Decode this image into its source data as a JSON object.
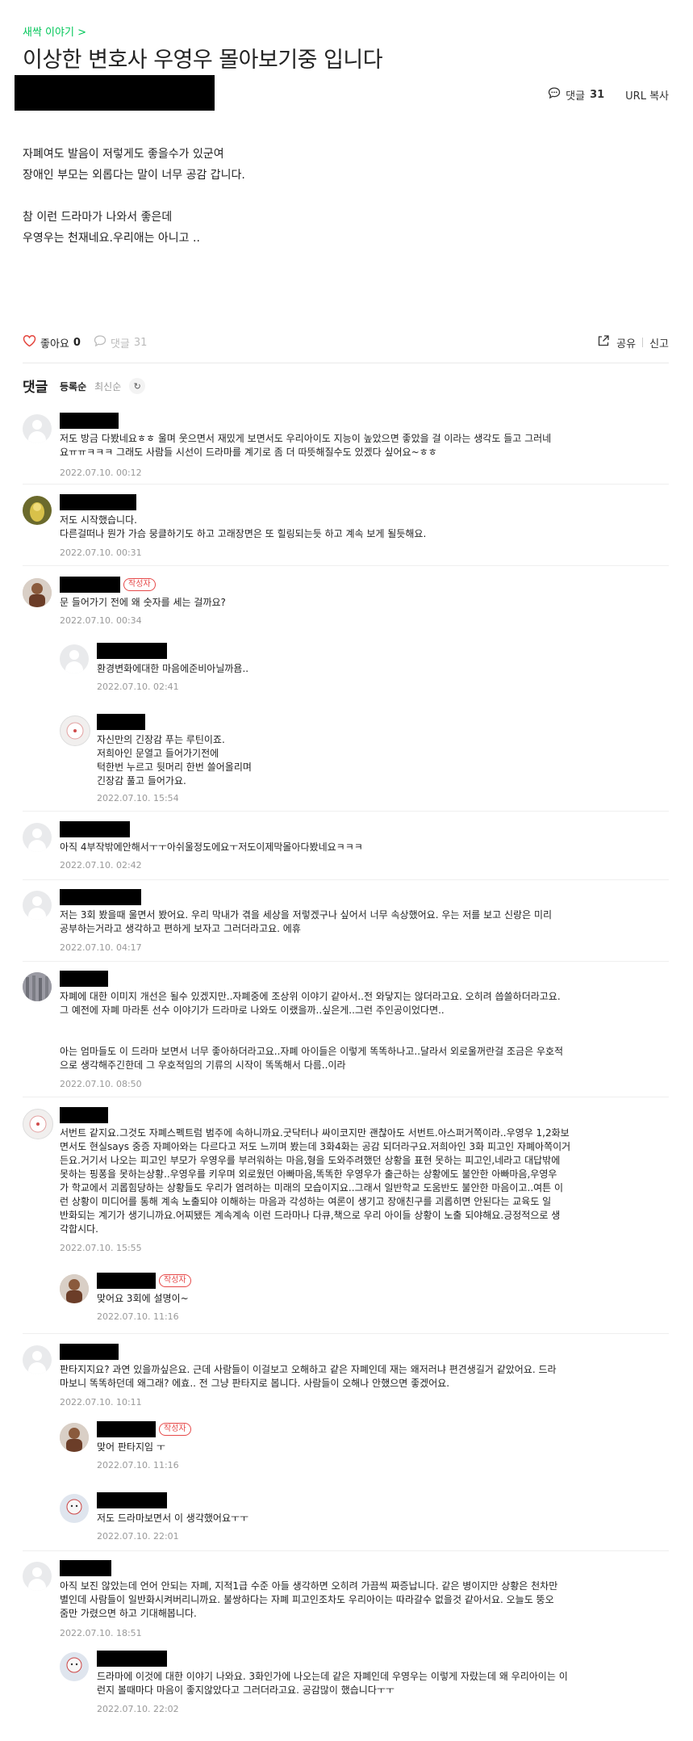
{
  "post": {
    "category": "새싹 이야기 >",
    "title": "이상한 변호사 우영우 몰아보기중 입니다",
    "comment_label": "댓글",
    "comment_count": "31",
    "url_copy": "URL 복사",
    "content_lines": [
      "자폐여도 발음이 저렇게도 좋을수가 있군여",
      "장애인 부모는 외롭다는 말이 너무 공감 갑니다.",
      "",
      "참 이런 드라마가 나와서 좋은데",
      "우영우는 천재네요.우리애는 아니고 .."
    ]
  },
  "actions": {
    "like_label": "좋아요",
    "like_count": "0",
    "comment_label": "댓글",
    "comment_count": "31",
    "share_label": "공유",
    "report_label": "신고"
  },
  "comments_section": {
    "title": "댓글",
    "sort_registered": "등록순",
    "sort_latest": "최신순"
  },
  "comments": [
    {
      "badge": "",
      "lines": [
        "저도 방금 다봤네요ㅎㅎ 울며 웃으면서 재밌게 보면서도 우리아이도 지능이 높았으면 좋았을 걸 이라는 생각도 들고 그러네",
        "요ㅠㅠㅋㅋㅋ 그래도 사람들 시선이 드라마를 계기로 좀 더 따뜻해질수도 있겠다 싶어요~ㅎㅎ"
      ],
      "date": "2022.07.10. 00:12"
    },
    {
      "badge": "",
      "lines": [
        "저도 시작했습니다.",
        "다른걸떠나 뭔가 가슴 뭉클하기도 하고 고래장면은 또 힐링되는듯 하고 계속 보게 될듯해요."
      ],
      "date": "2022.07.10. 00:31"
    },
    {
      "badge": "작성자",
      "lines": [
        "문 들어가기 전에 왜 숫자를 세는 걸까요?"
      ],
      "date": "2022.07.10. 00:34"
    },
    {
      "badge": "",
      "lines": [
        "환경변화에대한 마음에준비아닐까욤.."
      ],
      "date": "2022.07.10. 02:41"
    },
    {
      "badge": "",
      "lines": [
        "자신만의 긴장감 푸는 루틴이죠.",
        "저희아인 문열고 들어가기전에",
        "턱한번 누르고 뒷머리 한번 쓸어올리며",
        "긴장감 풀고 들어가요."
      ],
      "date": "2022.07.10. 15:54"
    },
    {
      "badge": "",
      "lines": [
        "아직 4부작밖에안해서ㅜㅜ아쉬울정도에요ㅜ저도이제막몰아다봤네요ㅋㅋㅋ"
      ],
      "date": "2022.07.10. 02:42"
    },
    {
      "badge": "",
      "lines": [
        "저는 3회 봤을때 울면서 봤어요. 우리 막내가 겪을 세상을 저렇겠구나 싶어서 너무 속상했어요. 우는 저를 보고 신랑은 미리",
        "공부하는거라고 생각하고 편하게 보자고 그러더라고요. 에휴"
      ],
      "date": "2022.07.10. 04:17"
    },
    {
      "badge": "",
      "lines": [
        "자폐에 대한 이미지 개선은 될수 있겠지만..자폐중에 조상위 이야기 같아서..전 와닿지는 않더라고요. 오히려 씁쓸하더라고요.",
        "그 예전에 자폐 마라톤 선수 이야기가 드라마로 나와도 이랬을까..싶은게..그런 주인공이었다면..",
        "",
        "",
        "아는 엄마들도 이 드라마 보면서 너무 좋아하더라고요..자폐 아이들은 이렇게 똑똑하나고..달라서 외로울꺼란걸 조금은 우호적",
        "으로 생각해주긴한데 그 우호적임의 기류의 시작이 똑똑해서 다름..이라"
      ],
      "date": "2022.07.10. 08:50"
    },
    {
      "badge": "",
      "lines": [
        "서번트 같지요.그것도 자폐스펙트럼 범주에 속하니까요.굿닥터나 싸이코지만 괜찮아도 서번트.아스퍼거쪽이라..우영우 1,2화보",
        "면서도 현실says 중증 자폐아와는 다르다고 저도 느끼며 봤는데 3화4화는 공감 되더라구요.저희아인 3화 피고인 자폐아쪽이거",
        "든요.거기서 나오는 피고인 부모가 우영우를 부러워하는 마음,형을 도와주려했던 상황을 표현 못하는 피고인,네라고 대답밖에",
        "못하는 핑퐁을 못하는상황..우영우를 키우며 외로웠던 아빠마음,똑똑한 우영우가 출근하는 상황에도 불안한 아빠마음,우영우",
        "가 학교에서 괴롭힘당하는 상황들도 우리가 염려하는 미래의 모습이지요..그래서 일반학교 도움반도 불안한 마음이고..여튼 이",
        "런 상황이 미디어를 통해 계속 노출되야 이해하는 마음과 각성하는 여론이 생기고 장애친구를 괴롭히면 안된다는 교육도 일",
        "반화되는 계기가 생기니까요.어찌됐든 계속계속 이런 드라마나 다큐,책으로 우리 아이들 상황이 노출 되야해요.긍정적으로 생",
        "각합시다."
      ],
      "date": "2022.07.10. 15:55"
    },
    {
      "badge": "작성자",
      "lines": [
        "맞어요 3회에 설명이~"
      ],
      "date": "2022.07.10. 11:16"
    },
    {
      "badge": "",
      "lines": [
        "판타지지요? 과연 있을까싶은요. 근데 사람들이 이걸보고 오해하고 같은 자폐인데 재는 왜저러냐 편견생길거 같았어요. 드라",
        "마보니 똑똑하던데 왜그래? 에효.. 전 그냥 판타지로 봅니다. 사람들이 오해나 안했으면 좋겠어요."
      ],
      "date": "2022.07.10. 10:11"
    },
    {
      "badge": "작성자",
      "lines": [
        "맞어 판타지임 ㅜ"
      ],
      "date": "2022.07.10. 11:16"
    },
    {
      "badge": "",
      "lines": [
        "저도 드라마보면서 이 생각했어요ㅜㅜ"
      ],
      "date": "2022.07.10. 22:01"
    },
    {
      "badge": "",
      "lines": [
        "아직 보진 않았는데 언어 안되는 자폐, 지적1급 수준 아들 생각하면 오히려 가끔씩 짜증납니다. 같은 병이지만 상황은 천차만",
        "별인데 사람들이 일반화시켜버리니까요. 불쌍하다는 자폐 피고인조차도 우리아이는 따라갈수 없을것 같아서요. 오늘도 뚱오",
        "줌만 가렸으면 하고 기대해봅니다."
      ],
      "date": "2022.07.10. 18:51"
    },
    {
      "badge": "",
      "lines": [
        "드라마에 이것에 대한 이야기 나와요. 3화인가에 나오는데 같은 자폐인데 우영우는 이렇게 자랐는데 왜 우리아이는 이",
        "런지 볼때마다 마음이 좋지않았다고 그러더라고요. 공감많이 했습니다ㅜㅜ"
      ],
      "date": "2022.07.10. 22:02"
    }
  ]
}
